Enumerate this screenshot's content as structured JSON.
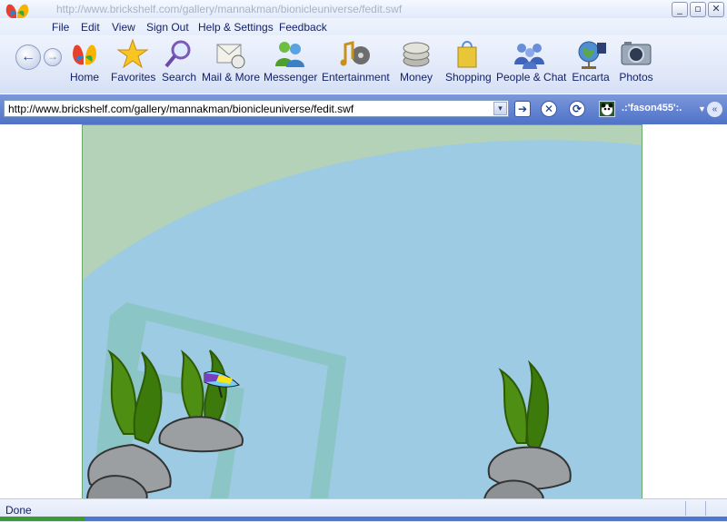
{
  "window": {
    "title": "http://www.brickshelf.com/gallery/mannakman/bionicleuniverse/fedit.swf",
    "controls": [
      "_",
      "▫",
      "✕"
    ]
  },
  "menu": [
    "File",
    "Edit",
    "View",
    "Sign Out",
    "Help & Settings",
    "Feedback"
  ],
  "toolbar": {
    "back": "←",
    "forward": "→",
    "buttons": [
      {
        "label": "Home",
        "icon": "butterfly-icon"
      },
      {
        "label": "Favorites",
        "icon": "star-icon"
      },
      {
        "label": "Search",
        "icon": "magnifier-icon"
      },
      {
        "label": "Mail & More",
        "icon": "mail-icon"
      },
      {
        "label": "Messenger",
        "icon": "messenger-icon"
      },
      {
        "label": "Entertainment",
        "icon": "music-film-icon"
      },
      {
        "label": "Money",
        "icon": "coins-icon"
      },
      {
        "label": "Shopping",
        "icon": "shopping-bag-icon"
      },
      {
        "label": "People & Chat",
        "icon": "people-icon"
      },
      {
        "label": "Encarta",
        "icon": "globe-icon"
      },
      {
        "label": "Photos",
        "icon": "camera-icon"
      }
    ]
  },
  "address": {
    "url": "http://www.brickshelf.com/gallery/mannakman/bionicleuniverse/fedit.swf",
    "drop": "▾",
    "go": "➔",
    "stop": "✕",
    "refresh": "⟳",
    "account": ".:'fason455':.",
    "account_drop": "▼",
    "collapse": "«"
  },
  "status": {
    "text": "Done"
  },
  "colors": {
    "water": "#9ccbe3",
    "surface": "#b4d2b8",
    "seaweed": "#4e8e12",
    "rock": "#9b9fa2"
  }
}
